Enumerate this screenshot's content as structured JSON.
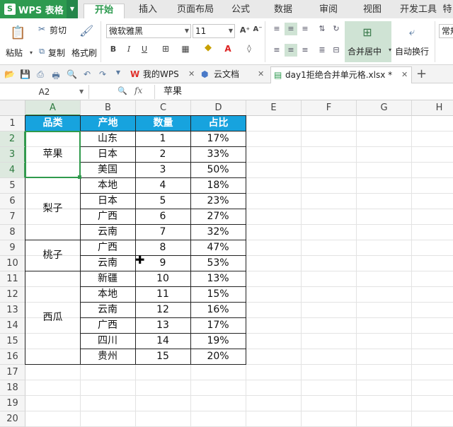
{
  "app": {
    "title": "WPS 表格",
    "logo": "S"
  },
  "menu": [
    "开始",
    "插入",
    "页面布局",
    "公式",
    "数据",
    "审阅",
    "视图",
    "开发工具",
    "特"
  ],
  "ribbon": {
    "paste": "粘贴",
    "cut": "剪切",
    "copy": "复制",
    "format_painter": "格式刷",
    "font_name": "微软雅黑",
    "font_size": "11",
    "grow_font": "A⁺",
    "shrink_font": "A⁻",
    "bold": "B",
    "italic": "I",
    "underline": "U",
    "merge_center": "合并居中",
    "wrap_text": "自动换行",
    "general": "常规"
  },
  "tabs": [
    {
      "label": "我的WPS"
    },
    {
      "label": "云文档"
    },
    {
      "label": "day1拒绝合并单元格.xlsx *"
    }
  ],
  "formula_bar": {
    "name_box": "A2",
    "fx": "fx",
    "content": "苹果"
  },
  "grid": {
    "columns": [
      "A",
      "B",
      "C",
      "D",
      "E",
      "F",
      "G",
      "H"
    ],
    "rows": [
      "1",
      "2",
      "3",
      "4",
      "5",
      "6",
      "7",
      "8",
      "9",
      "10",
      "11",
      "12",
      "13",
      "14",
      "15",
      "16",
      "17",
      "18",
      "19",
      "20"
    ],
    "headers": [
      "品类",
      "产地",
      "数量",
      "占比"
    ],
    "categories": [
      {
        "name": "苹果"
      },
      {
        "name": "梨子"
      },
      {
        "name": "桃子"
      },
      {
        "name": "西瓜"
      }
    ],
    "records": [
      {
        "origin": "山东",
        "qty": "1",
        "pct": "17%"
      },
      {
        "origin": "日本",
        "qty": "2",
        "pct": "33%"
      },
      {
        "origin": "美国",
        "qty": "3",
        "pct": "50%"
      },
      {
        "origin": "本地",
        "qty": "4",
        "pct": "18%"
      },
      {
        "origin": "日本",
        "qty": "5",
        "pct": "23%"
      },
      {
        "origin": "广西",
        "qty": "6",
        "pct": "27%"
      },
      {
        "origin": "云南",
        "qty": "7",
        "pct": "32%"
      },
      {
        "origin": "广西",
        "qty": "8",
        "pct": "47%"
      },
      {
        "origin": "云南",
        "qty": "9",
        "pct": "53%"
      },
      {
        "origin": "新疆",
        "qty": "10",
        "pct": "13%"
      },
      {
        "origin": "本地",
        "qty": "11",
        "pct": "15%"
      },
      {
        "origin": "云南",
        "qty": "12",
        "pct": "16%"
      },
      {
        "origin": "广西",
        "qty": "13",
        "pct": "17%"
      },
      {
        "origin": "四川",
        "qty": "14",
        "pct": "19%"
      },
      {
        "origin": "贵州",
        "qty": "15",
        "pct": "20%"
      }
    ]
  },
  "colors": {
    "header_fill": "#17a3de",
    "accent": "#2d9a4f",
    "selection": "#2f9a4c"
  }
}
